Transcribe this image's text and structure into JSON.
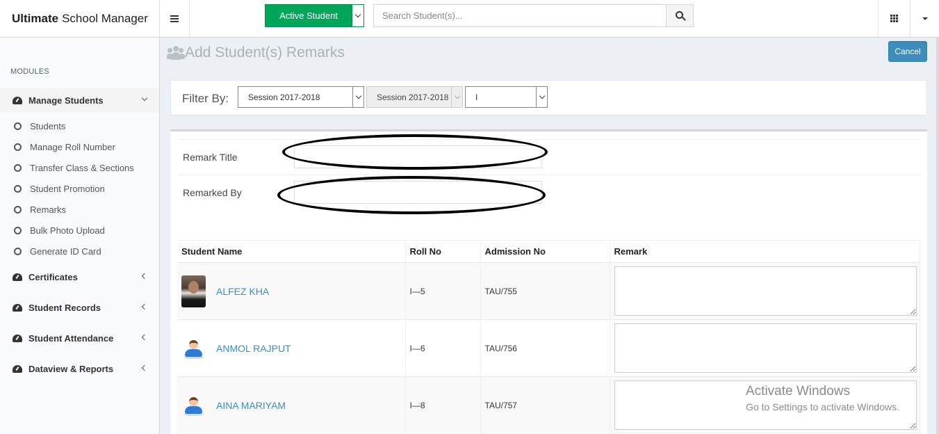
{
  "brand": {
    "bold": "Ultimate",
    "rest": "School Manager"
  },
  "topbar": {
    "active_student_label": "Active Student",
    "search_placeholder": "Search Student(s)..."
  },
  "sidebar": {
    "section_label": "MODULES",
    "groups": [
      {
        "label": "Manage Students",
        "expanded": true
      },
      {
        "label": "Certificates",
        "expanded": false
      },
      {
        "label": "Student Records",
        "expanded": false
      },
      {
        "label": "Student Attendance",
        "expanded": false
      },
      {
        "label": "Dataview & Reports",
        "expanded": false
      }
    ],
    "subitems": [
      "Students",
      "Manage Roll Number",
      "Transfer Class & Sections",
      "Student Promotion",
      "Remarks",
      "Bulk Photo Upload",
      "Generate ID Card"
    ]
  },
  "page": {
    "title": "Add Student(s) Remarks",
    "cancel_label": "Cancel"
  },
  "filter": {
    "label": "Filter By:",
    "session_select": "Session 2017-2018",
    "session_select_disabled": "Session 2017-2018",
    "class_select": "I"
  },
  "form": {
    "remark_title_label": "Remark Title",
    "remarked_by_label": "Remarked By",
    "remark_title_value": "",
    "remarked_by_value": ""
  },
  "table": {
    "columns": [
      "Student Name",
      "Roll No",
      "Admission No",
      "Remark"
    ],
    "rows": [
      {
        "name": "ALFEZ KHA",
        "roll": "I—5",
        "admission": "TAU/755",
        "photo": "student-photo"
      },
      {
        "name": "ANMOL RAJPUT",
        "roll": "I—6",
        "admission": "TAU/756",
        "photo": "default-avatar-icon"
      },
      {
        "name": "AINA MARIYAM",
        "roll": "I—8",
        "admission": "TAU/757",
        "photo": "default-avatar-icon"
      }
    ]
  },
  "watermark": {
    "line1": "Activate Windows",
    "line2": "Go to Settings to activate Windows."
  },
  "colors": {
    "green": "#00a65a",
    "blue": "#3c8dbc",
    "content_bg": "#ecf0f5"
  }
}
